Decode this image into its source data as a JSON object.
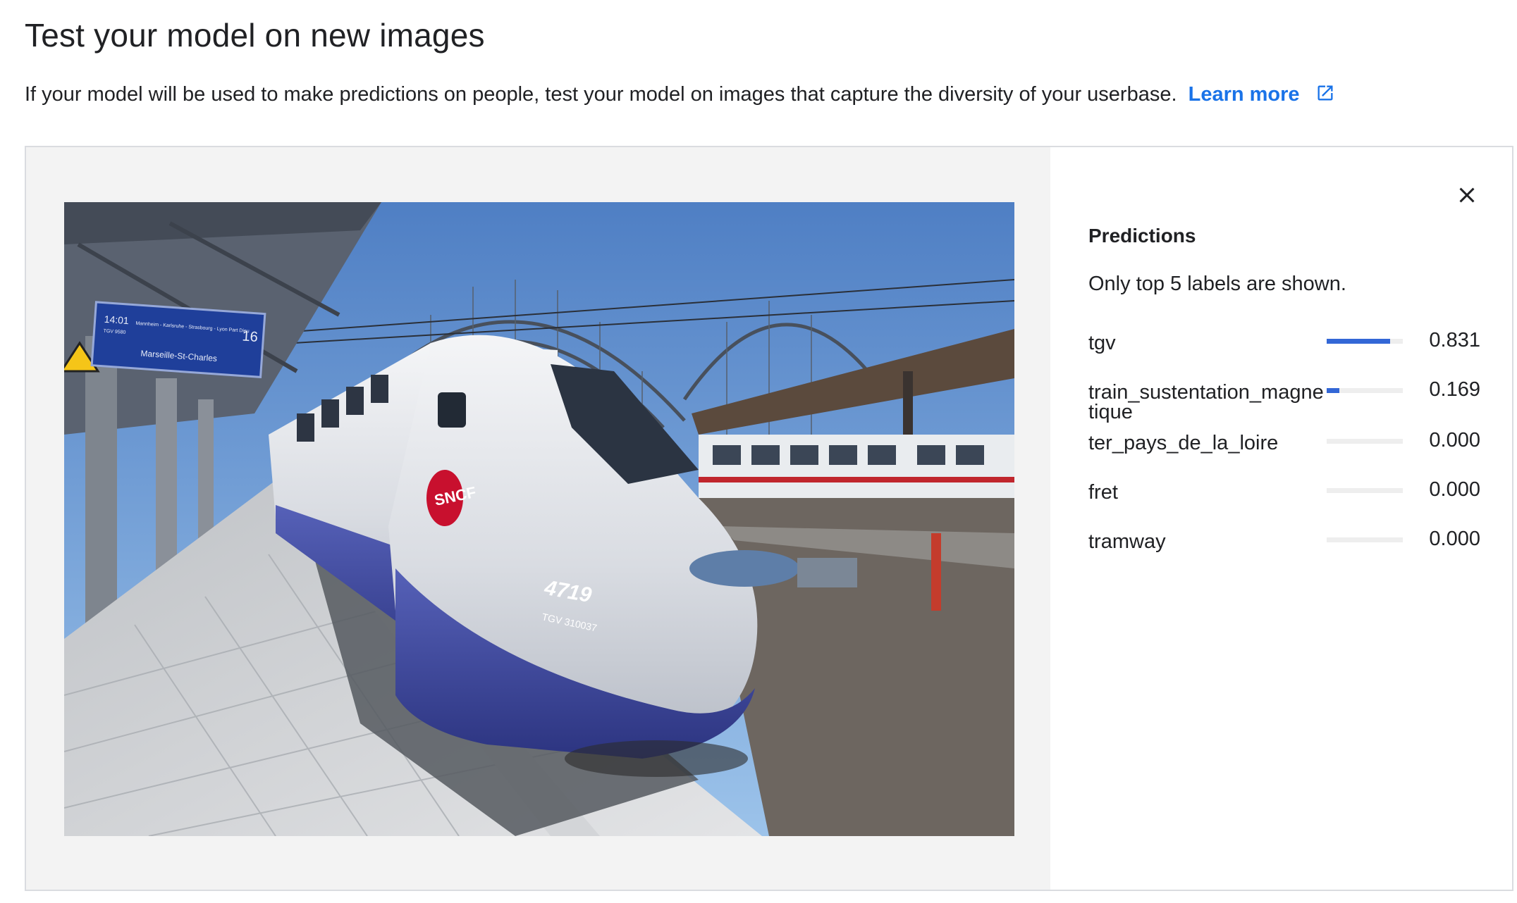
{
  "header": {
    "title": "Test your model on new images",
    "description": "If your model will be used to make predictions on people, test your model on images that capture the diversity of your userbase.",
    "learn_more": "Learn more"
  },
  "image": {
    "board_time": "14:01",
    "board_train": "TGV 9580",
    "board_via": "Mannheim - Karlsruhe - Strasbourg - Lyon Part Dieu",
    "board_platform": "16",
    "board_destination": "Marseille-St-Charles",
    "train_logo": "SNCF",
    "train_number": "4719",
    "train_code": "TGV 310037"
  },
  "predictions": {
    "title": "Predictions",
    "note": "Only top 5 labels are shown.",
    "items": [
      {
        "label": "tgv",
        "value": "0.831",
        "score": 0.831
      },
      {
        "label": "train_sustentation_magnetique",
        "value": "0.169",
        "score": 0.169
      },
      {
        "label": "ter_pays_de_la_loire",
        "value": "0.000",
        "score": 0.0
      },
      {
        "label": "fret",
        "value": "0.000",
        "score": 0.0
      },
      {
        "label": "tramway",
        "value": "0.000",
        "score": 0.0
      }
    ]
  },
  "icons": {
    "external_link": "open-in-new-icon",
    "close": "close-icon"
  },
  "colors": {
    "link": "#1a73e8",
    "bar": "#3367d6",
    "image_pane_bg": "#f3f3f3"
  }
}
